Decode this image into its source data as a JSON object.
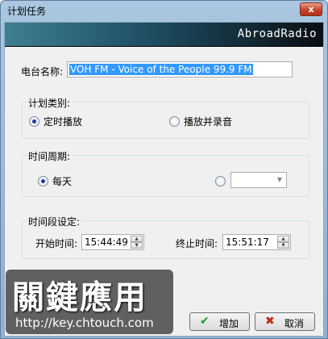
{
  "window": {
    "title": "计划任务",
    "close_label": "x"
  },
  "banner": {
    "text": "AbroadRadio"
  },
  "station": {
    "label": "电台名称:",
    "value": "VOH FM - Voice of the People 99.9 FM"
  },
  "plan_type": {
    "title": "计划类别:",
    "options": [
      {
        "label": "定时播放",
        "checked": true
      },
      {
        "label": "播放并录音",
        "checked": false
      }
    ]
  },
  "period": {
    "title": "时间周期:",
    "daily_label": "每天",
    "daily_checked": true,
    "custom_checked": false,
    "custom_value": ""
  },
  "timeslot": {
    "title": "时间段设定:",
    "start_label": "开始时间:",
    "start_value": "15:44:49",
    "end_label": "终止时间:",
    "end_value": "15:51:17"
  },
  "buttons": {
    "add_label": "增加",
    "cancel_label": "取消"
  },
  "watermark": {
    "text": "關鍵應用",
    "url": "http://key.chtouch.com"
  },
  "colors": {
    "selection": "#3399ff",
    "banner_dark": "#0a0f14",
    "banner_teal": "#3f7f93"
  }
}
